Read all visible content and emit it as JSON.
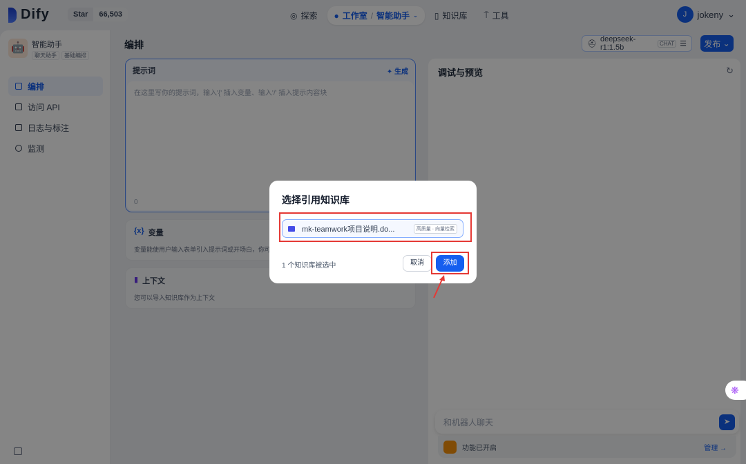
{
  "header": {
    "brand": "Dify",
    "star_label": "Star",
    "star_count": "66,503",
    "nav": [
      {
        "label": "探索",
        "icon": "compass-icon"
      },
      {
        "label": "工作室",
        "icon": "robot-icon"
      },
      {
        "label": "智能助手"
      },
      {
        "label": "知识库",
        "icon": "book-icon"
      },
      {
        "label": "工具",
        "icon": "hammer-icon"
      }
    ],
    "user": {
      "initial": "J",
      "name": "jokeny"
    }
  },
  "sidebar": {
    "app_name": "智能助手",
    "tags": [
      "聊天助手",
      "基础编排"
    ],
    "items": [
      {
        "label": "编排",
        "active": true
      },
      {
        "label": "访问 API"
      },
      {
        "label": "日志与标注"
      },
      {
        "label": "监测"
      }
    ]
  },
  "main": {
    "title": "编排",
    "model": "deepseek-r1:1.5b",
    "model_tag": "CHAT",
    "publish": "发布",
    "prompt": {
      "title": "提示词",
      "generate": "生成",
      "placeholder": "在这里写你的提示词，输入'{' 插入变量、输入'/' 插入提示内容块",
      "count": "0"
    },
    "variables": {
      "title": "变量",
      "desc": "变量能使用户输入表单引入提示词或开场白，你可以"
    },
    "context": {
      "title": "上下文",
      "desc": "您可以导入知识库作为上下文"
    }
  },
  "preview": {
    "title": "调试与预览",
    "chat_placeholder": "和机器人聊天",
    "features": "功能已开启",
    "manage": "管理"
  },
  "dialog": {
    "title": "选择引用知识库",
    "kb_name": "mk-teamwork项目说明.do...",
    "kb_tag": "高质量 · 向量检索",
    "selected": "1 个知识库被选中",
    "cancel": "取消",
    "add": "添加"
  },
  "colors": {
    "accent": "#155eef",
    "highlight": "#e53935"
  }
}
